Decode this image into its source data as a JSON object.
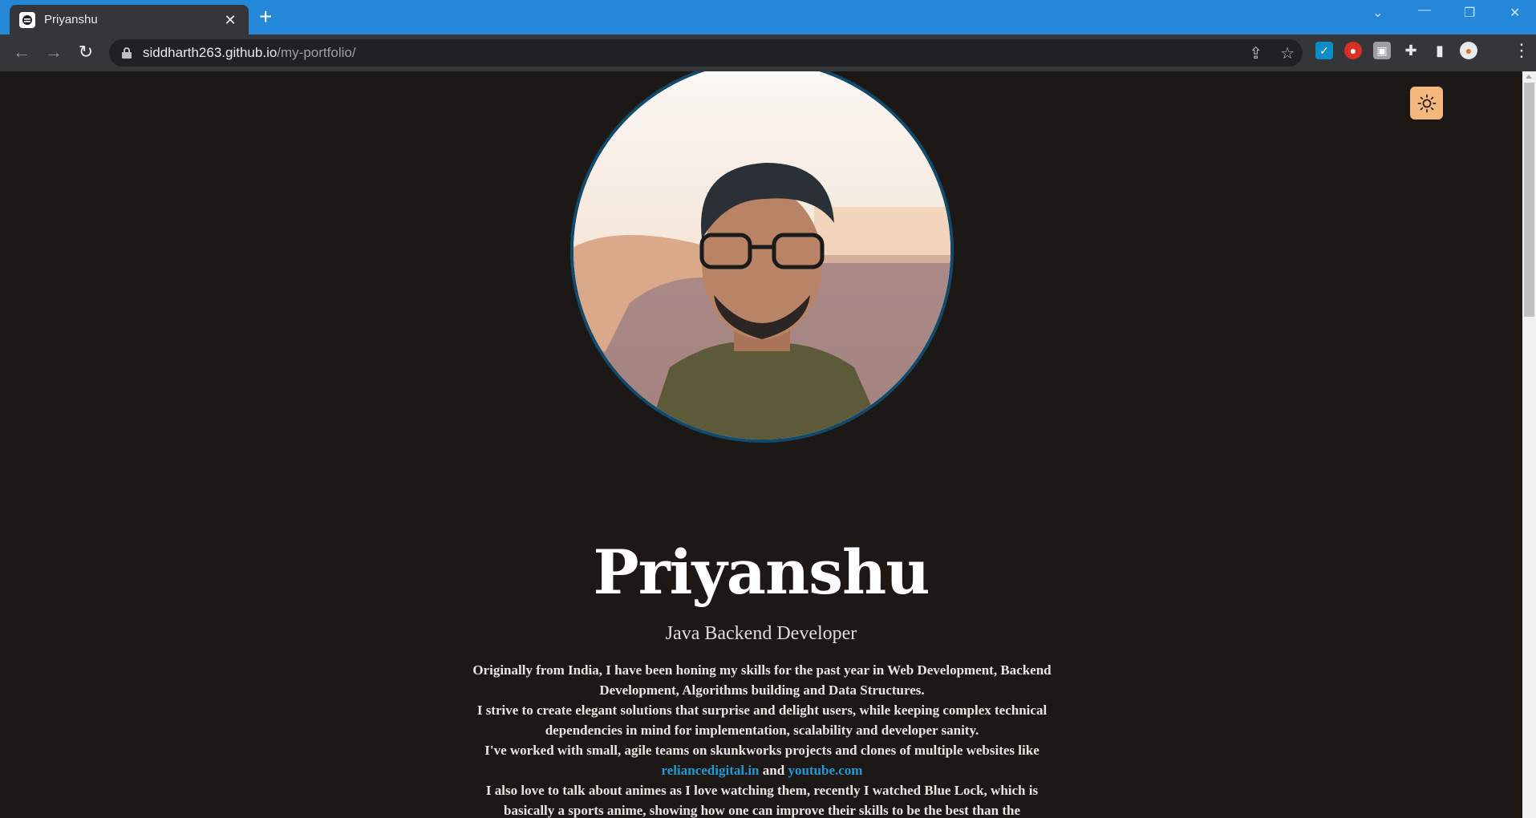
{
  "browser": {
    "tab_title": "Priyanshu",
    "url_host": "siddharth263.github.io",
    "url_path": "/my-portfolio/"
  },
  "page": {
    "name": "Priyanshu",
    "role": "Java Backend Developer",
    "bio_lines": [
      "Originally from India, I have been honing my skills for the past year in Web Development, Backend Development, Algorithms building and Data Structures.",
      "I strive to create elegant solutions that surprise and delight users, while keeping complex technical dependencies in mind for implementation, scalability and developer sanity.",
      "I've worked with small, agile teams on skunkworks projects and clones of multiple websites like",
      "I also love to talk about animes as I love watching them, recently I watched Blue Lock, which is basically a sports anime, showing how one can improve their skills to be the best than the"
    ],
    "link_reliance": "reliancedigital.in",
    "link_and": "and",
    "link_youtube": "youtube.com"
  },
  "colors": {
    "page_bg": "#1c1816",
    "accent_link": "#1f9ad6",
    "toggle_bg": "#f6b77d",
    "avatar_border": "#114a6b",
    "titlebar": "#2487d8"
  },
  "icons": [
    "sun-icon",
    "lock-icon",
    "back-arrow-icon",
    "forward-arrow-icon",
    "reload-icon",
    "share-icon",
    "star-icon",
    "extensions-icon",
    "side-panel-icon",
    "menu-icon"
  ]
}
